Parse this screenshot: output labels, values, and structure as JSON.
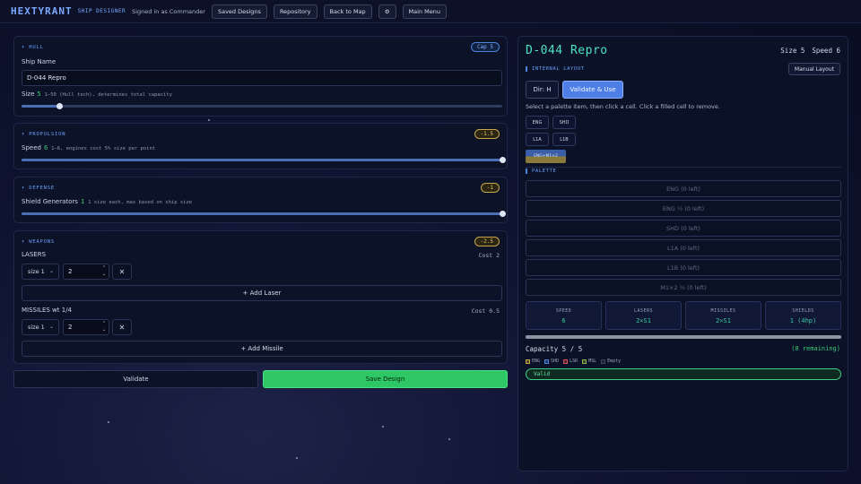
{
  "app": {
    "logo": "HEXTYRANT",
    "subtitle": "SHIP DESIGNER",
    "signed_in": "Signed in as Commander"
  },
  "nav": {
    "saved_designs": "Saved Designs",
    "repository": "Repository",
    "back_to_map": "Back to Map",
    "settings_icon": "⚙",
    "main_menu": "Main Menu"
  },
  "hull": {
    "title": "▾ HULL",
    "badge": "Cap 5",
    "ship_name_label": "Ship Name",
    "ship_name_value": "D-044 Repro",
    "size_label": "Size",
    "size_value": "5",
    "size_hint": "1–50 (Hull tech), determines total capacity",
    "size_fraction": 0.08
  },
  "propulsion": {
    "title": "▾ PROPULSION",
    "badge": "-1.5",
    "speed_label": "Speed",
    "speed_value": "6",
    "speed_hint": "1–6, engines cost 5% size per point",
    "speed_fraction": 1.0
  },
  "defense": {
    "title": "▾ DEFENSE",
    "badge": "-1",
    "shield_label": "Shield Generators",
    "shield_value": "1",
    "shield_hint": "1 size each, max based on ship size",
    "shield_fraction": 1.0
  },
  "weapons": {
    "title": "▾ WEAPONS",
    "badge": "-2.5",
    "lasers_label": "LASERS",
    "lasers_cost": "Cost 2",
    "laser_size": "size 1",
    "laser_count": "2",
    "add_laser": "+ Add Laser",
    "missiles_label": "MISSILES wt 1/4",
    "missiles_cost": "Cost 0.5",
    "missile_size": "size 1",
    "missile_count": "2",
    "add_missile": "+ Add Missile"
  },
  "actions": {
    "validate": "Validate",
    "save": "Save Design"
  },
  "right": {
    "ship_name": "D-044 Repro",
    "size_stat": "Size 5",
    "speed_stat": "Speed 6",
    "internal_layout": "INTERNAL LAYOUT",
    "manual_layout": "Manual Layout",
    "dir": "Dir: H",
    "validate_use": "Validate & Use",
    "instruction": "Select a palette item, then click a cell. Click a filled cell to remove.",
    "chips": [
      "ENG",
      "SHD",
      "L1A",
      "L1B"
    ],
    "special_chip": "ENG+M1×2",
    "palette_title": "PALETTE",
    "palette": [
      "ENG (0 left)",
      "ENG ½ (0 left)",
      "SHD (0 left)",
      "L1A (0 left)",
      "L1B (0 left)",
      "M1×2 ½ (0 left)"
    ],
    "stats": [
      {
        "k": "SPEED",
        "v": "6"
      },
      {
        "k": "LASERS",
        "v": "2×S1"
      },
      {
        "k": "MISSILES",
        "v": "2×S1"
      },
      {
        "k": "SHIELDS",
        "v": "1 (4hp)"
      }
    ],
    "capacity_text": "Capacity 5 / 5",
    "capacity_remaining": "(0 remaining)",
    "capacity_fraction": 1.0,
    "legend": [
      {
        "label": "ENG",
        "color": "#c9a64a"
      },
      {
        "label": "SHD",
        "color": "#4d84d8"
      },
      {
        "label": "LSR",
        "color": "#d0525a"
      },
      {
        "label": "MSL",
        "color": "#8ab04a"
      },
      {
        "label": "Empty",
        "color": "#3a4462"
      }
    ],
    "status": "Valid"
  }
}
